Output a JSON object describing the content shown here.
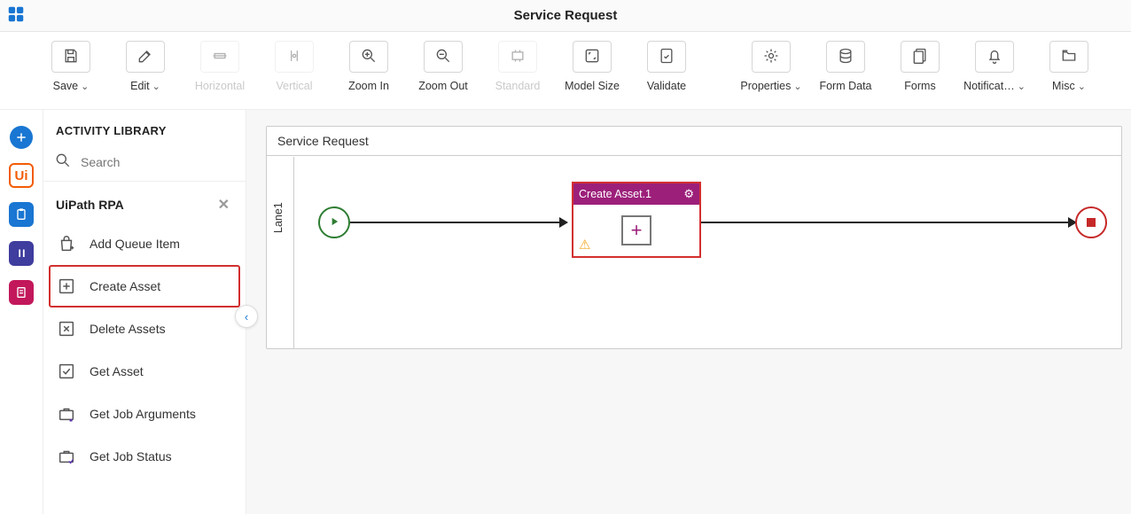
{
  "app": {
    "title": "Service Request"
  },
  "toolbar": {
    "save": "Save",
    "edit": "Edit",
    "horizontal": "Horizontal",
    "vertical": "Vertical",
    "zoom_in": "Zoom In",
    "zoom_out": "Zoom Out",
    "standard": "Standard",
    "model_size": "Model Size",
    "validate": "Validate",
    "properties": "Properties",
    "form_data": "Form Data",
    "forms": "Forms",
    "notifications": "Notificat…",
    "misc": "Misc"
  },
  "sidebar": {
    "heading": "ACTIVITY LIBRARY",
    "search_placeholder": "Search",
    "category": "UiPath RPA",
    "items": [
      {
        "label": "Add Queue Item"
      },
      {
        "label": "Create Asset"
      },
      {
        "label": "Delete Assets"
      },
      {
        "label": "Get Asset"
      },
      {
        "label": "Get Job Arguments"
      },
      {
        "label": "Get Job Status"
      }
    ]
  },
  "canvas": {
    "title": "Service Request",
    "lane": "Lane1",
    "task_name": "Create Asset.1"
  }
}
